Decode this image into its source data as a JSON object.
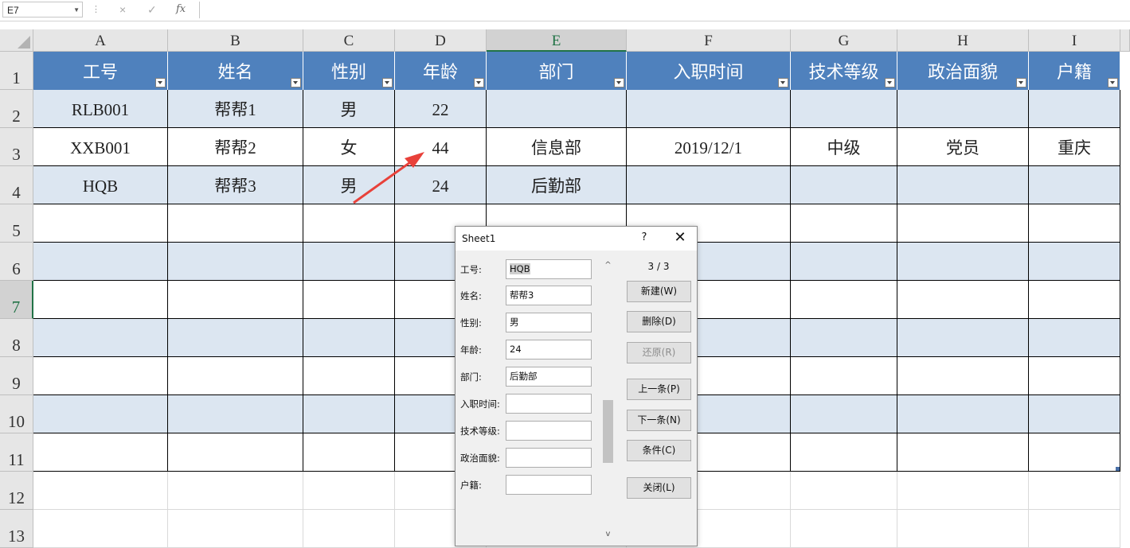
{
  "formula_bar": {
    "name_box": "E7",
    "cancel_icon": "×",
    "enter_icon": "✓",
    "fx_icon": "fx",
    "formula": ""
  },
  "columns": [
    "A",
    "B",
    "C",
    "D",
    "E",
    "F",
    "G",
    "H",
    "I"
  ],
  "rows": [
    "1",
    "2",
    "3",
    "4",
    "5",
    "6",
    "7",
    "8",
    "9",
    "10",
    "11",
    "12",
    "13"
  ],
  "selected_cell": "E7",
  "table": {
    "headers": [
      "工号",
      "姓名",
      "性别",
      "年龄",
      "部门",
      "入职时间",
      "技术等级",
      "政治面貌",
      "户籍"
    ],
    "records": [
      [
        "RLB001",
        "帮帮1",
        "男",
        "22",
        "",
        "",
        "",
        "",
        ""
      ],
      [
        "XXB001",
        "帮帮2",
        "女",
        "44",
        "信息部",
        "2019/12/1",
        "中级",
        "党员",
        "重庆"
      ],
      [
        "HQB",
        "帮帮3",
        "男",
        "24",
        "后勤部",
        "",
        "",
        "",
        ""
      ]
    ]
  },
  "colors": {
    "header_fill": "#4f81bd",
    "band_fill": "#dce6f1",
    "selection_green": "#217346",
    "annotation_arrow": "#e8413a"
  },
  "dialog": {
    "title": "Sheet1",
    "help": "?",
    "close": "✕",
    "fields": [
      {
        "label": "工号:",
        "value": "HQB"
      },
      {
        "label": "姓名:",
        "value": "帮帮3"
      },
      {
        "label": "性别:",
        "value": "男"
      },
      {
        "label": "年龄:",
        "value": "24"
      },
      {
        "label": "部门:",
        "value": "后勤部"
      },
      {
        "label": "入职时间:",
        "value": ""
      },
      {
        "label": "技术等级:",
        "value": ""
      },
      {
        "label": "政治面貌:",
        "value": ""
      },
      {
        "label": "户籍:",
        "value": ""
      }
    ],
    "record_counter": "3 / 3",
    "buttons": {
      "new": "新建(W)",
      "delete": "删除(D)",
      "restore": "还原(R)",
      "prev": "上一条(P)",
      "next": "下一条(N)",
      "criteria": "条件(C)",
      "close": "关闭(L)"
    },
    "scroll_up": "^",
    "scroll_down": "v"
  }
}
